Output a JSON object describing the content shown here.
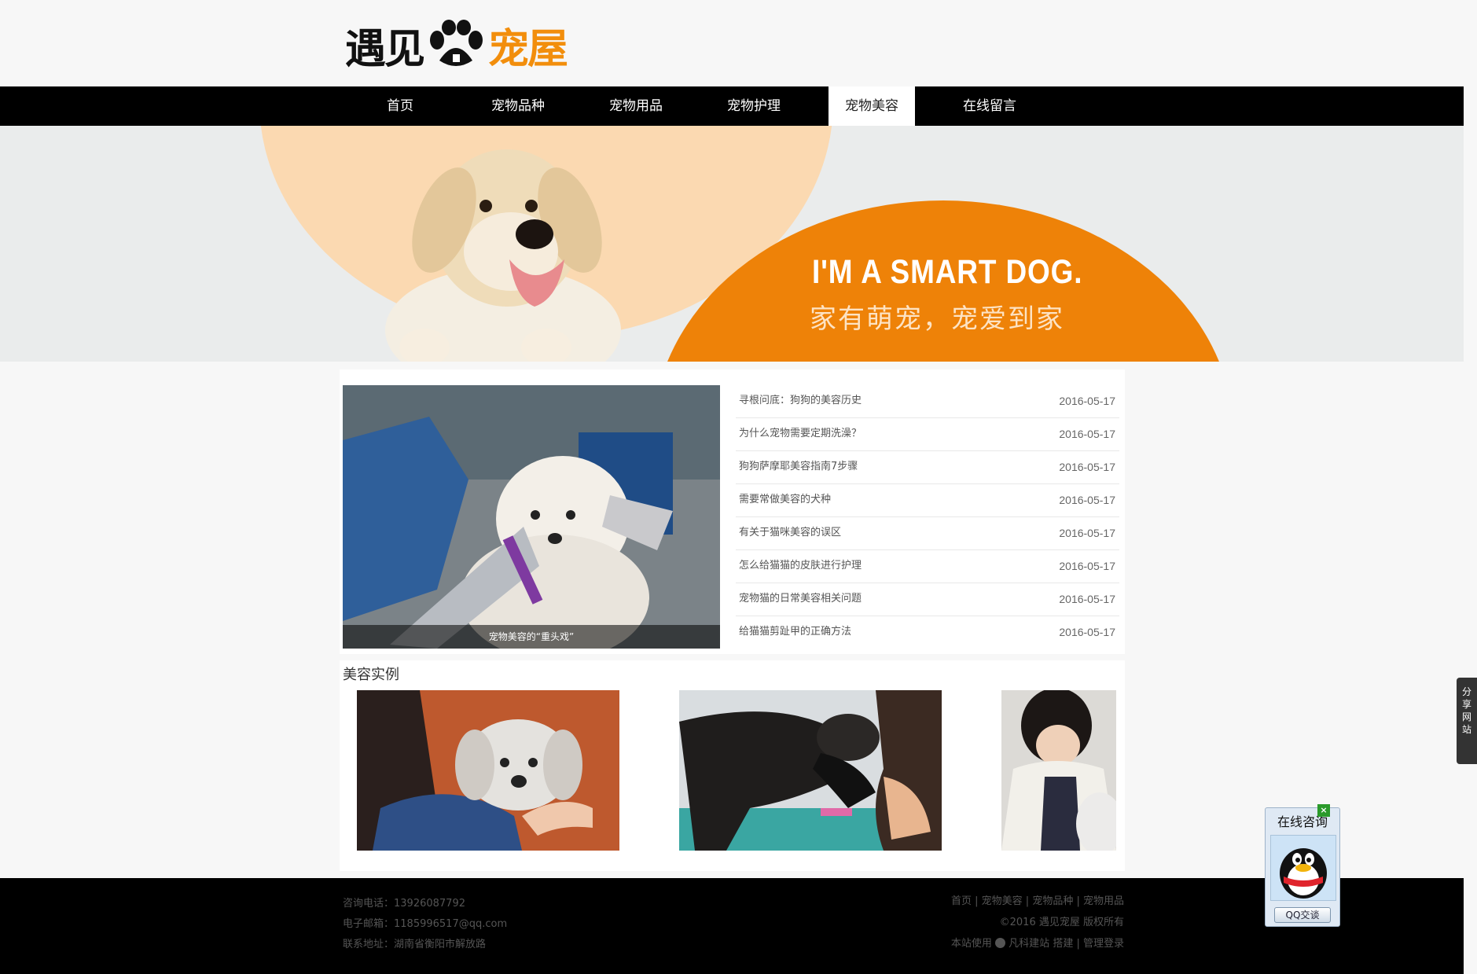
{
  "logo": {
    "part1": "遇见",
    "part2": "宠屋"
  },
  "nav": {
    "items": [
      {
        "label": "首页"
      },
      {
        "label": "宠物品种"
      },
      {
        "label": "宠物用品"
      },
      {
        "label": "宠物护理"
      },
      {
        "label": "宠物美容",
        "active": true
      },
      {
        "label": "在线留言"
      }
    ]
  },
  "banner": {
    "headline": "I'M A SMART DOG.",
    "subline": "家有萌宠，宠爱到家"
  },
  "feature": {
    "caption": "宠物美容的“重头戏”"
  },
  "news": [
    {
      "title": "寻根问底：狗狗的美容历史",
      "date": "2016-05-17"
    },
    {
      "title": "为什么宠物需要定期洗澡？",
      "date": "2016-05-17"
    },
    {
      "title": "狗狗萨摩耶美容指南7步骤",
      "date": "2016-05-17"
    },
    {
      "title": "需要常做美容的犬种",
      "date": "2016-05-17"
    },
    {
      "title": "有关于猫咪美容的误区",
      "date": "2016-05-17"
    },
    {
      "title": "怎么给猫猫的皮肤进行护理",
      "date": "2016-05-17"
    },
    {
      "title": "宠物猫的日常美容相关问题",
      "date": "2016-05-17"
    },
    {
      "title": "给猫猫剪趾甲的正确方法",
      "date": "2016-05-17"
    }
  ],
  "cases": {
    "title": "美容实例"
  },
  "footer": {
    "phone": "咨询电话：13926087792",
    "email": "电子邮箱：1185996517@qq.com",
    "address": "联系地址：湖南省衡阳市解放路",
    "links": [
      "首页",
      "宠物美容",
      "宠物品种",
      "宠物用品"
    ],
    "copyright": "©2016 遇见宠屋 版权所有",
    "powered_prefix": "本站使用",
    "powered_brand": "凡科建站",
    "powered_suffix": "搭建",
    "admin": "管理登录"
  },
  "share": {
    "label": "分享网站"
  },
  "qq": {
    "title": "在线咨询",
    "button": "QQ交谈",
    "close": "×"
  },
  "colors": {
    "accent": "#ee8208",
    "nav_bg": "#000000",
    "peach": "#fbd9b1"
  }
}
